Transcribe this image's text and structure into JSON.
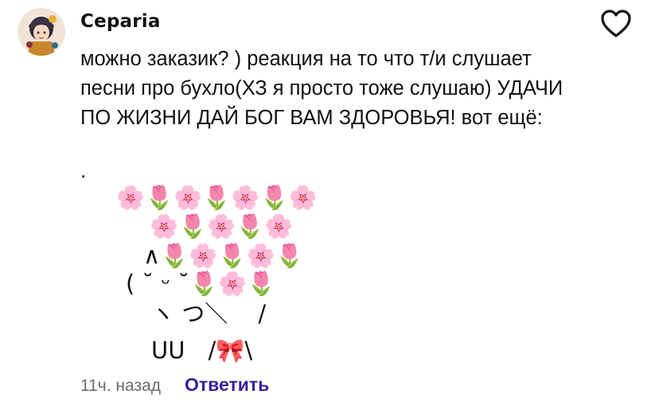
{
  "comment": {
    "author": "Ceparia",
    "avatar": "avatar-illustration",
    "like_icon": "heart-outline-icon",
    "text": "можно заказик? ) реакция на то что т/и слушает песни про бухло(ХЗ я просто тоже слушаю) УДАЧИ ПО ЖИЗНИ ДАЙ БОГ ВАМ ЗДОРОВЬЯ! вот ещё:",
    "dot": ".",
    "art": [
      "🌸🌷🌸🌷🌸🌷🌸",
      "🌸🌷🌸🌷🌸",
      "∧🌷🌸🌷🌸🌷",
      "( ˘ ᵕ ˘🌷🌸🌷",
      "ヽ つ＼　 /",
      "UU　/🎀\\"
    ],
    "timestamp": "11ч. назад",
    "reply_label": "Ответить"
  },
  "colors": {
    "accent": "#3b1f9c",
    "muted": "#6b6b6b"
  }
}
